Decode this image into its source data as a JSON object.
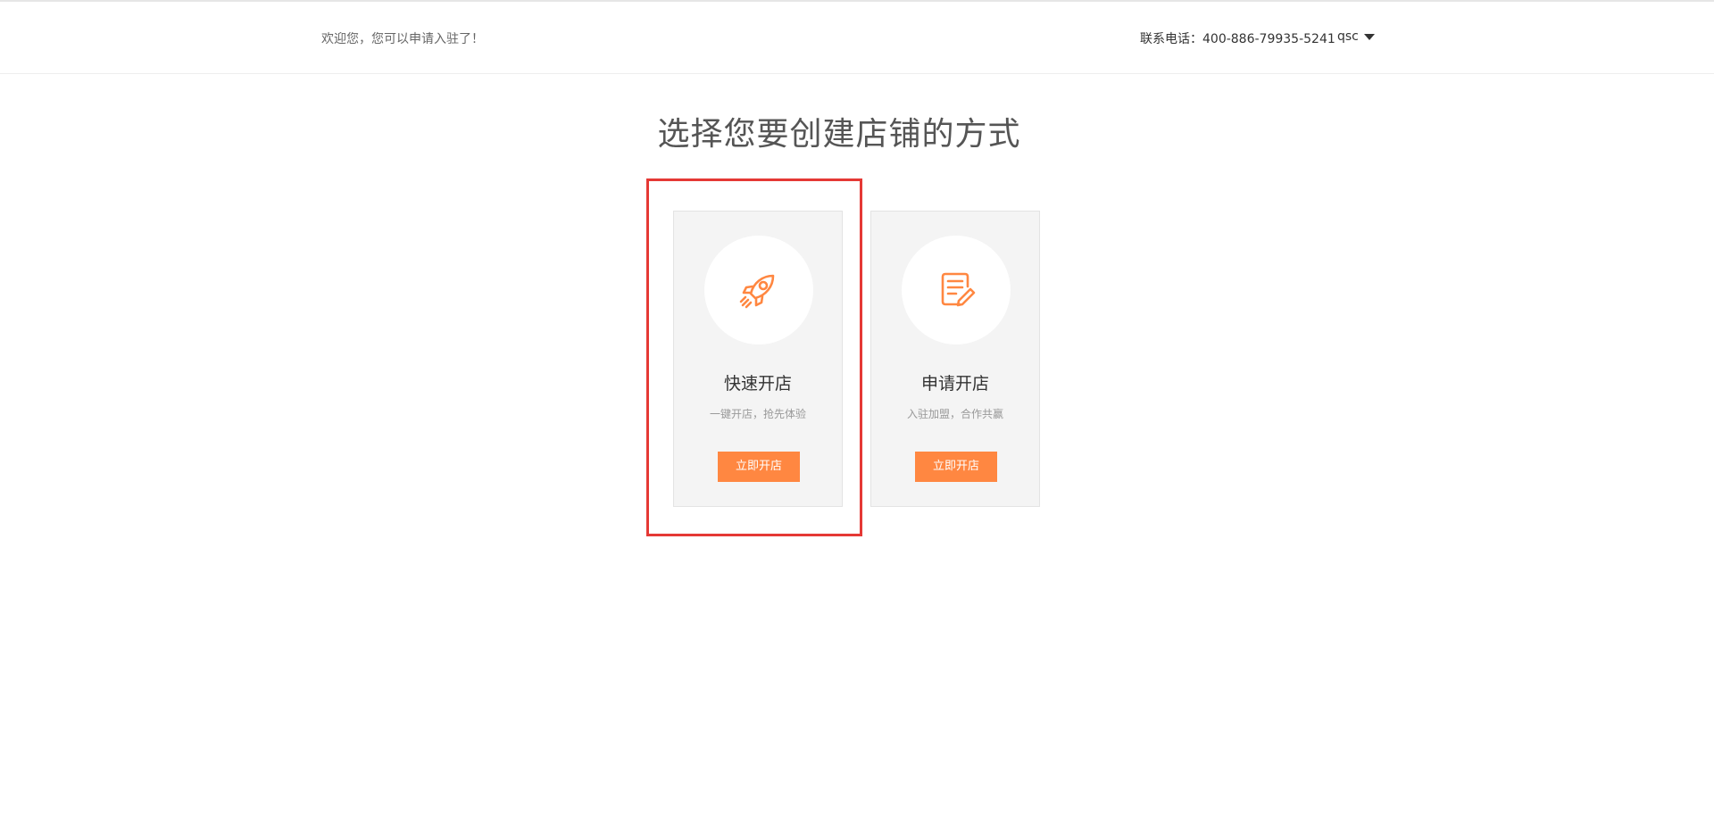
{
  "header": {
    "welcome_text": "欢迎您，您可以申请入驻了！",
    "contact_label": "联系电话：",
    "contact_number": "400-886-79935-5241",
    "username": "qsc"
  },
  "main": {
    "title": "选择您要创建店铺的方式",
    "cards": [
      {
        "icon": "rocket-icon",
        "title": "快速开店",
        "description": "一键开店，抢先体验",
        "button_label": "立即开店"
      },
      {
        "icon": "document-edit-icon",
        "title": "申请开店",
        "description": "入驻加盟，合作共赢",
        "button_label": "立即开店"
      }
    ]
  },
  "colors": {
    "accent": "#ff8741",
    "highlight": "#e53935",
    "card_background": "#f4f4f4"
  }
}
